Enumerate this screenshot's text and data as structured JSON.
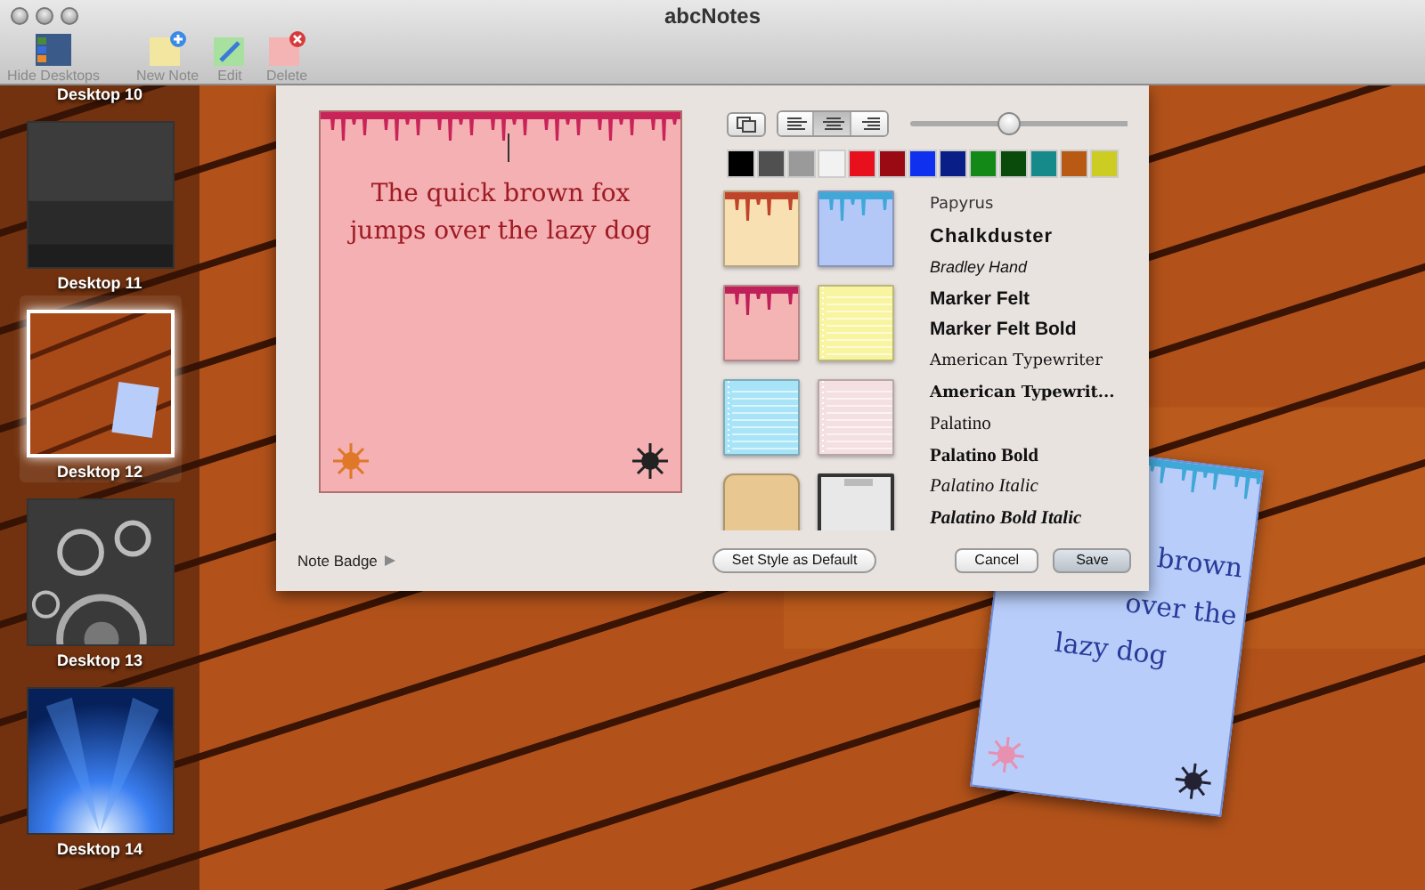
{
  "window": {
    "title": "abcNotes"
  },
  "toolbar": [
    {
      "label": "Hide Desktops",
      "kind": "desktops"
    },
    {
      "label": "New Note",
      "kind": "new"
    },
    {
      "label": "Edit",
      "kind": "edit"
    },
    {
      "label": "Delete",
      "kind": "delete"
    }
  ],
  "sidebar": {
    "items": [
      {
        "label": "Desktop 10",
        "kind": "label",
        "selected": false
      },
      {
        "label": "Desktop 11",
        "kind": "thumbnail",
        "selected": false
      },
      {
        "label": "Desktop 12",
        "kind": "thumbnail",
        "selected": true
      },
      {
        "label": "Desktop 13",
        "kind": "thumbnail",
        "selected": false
      },
      {
        "label": "Desktop 14",
        "kind": "thumbnail",
        "selected": false
      }
    ]
  },
  "style_sheet": {
    "preview": {
      "text": "The quick brown fox jumps over the lazy dog"
    },
    "alignment": [
      {
        "kind": "left",
        "selected": false
      },
      {
        "kind": "center",
        "selected": true
      },
      {
        "kind": "right",
        "selected": false
      }
    ],
    "size_slider": {
      "level": 0.45
    },
    "colors": [
      {
        "color": "#000000"
      },
      {
        "color": "#505050"
      },
      {
        "color": "#9a9a9a"
      },
      {
        "color": "#f2f2f2"
      },
      {
        "color": "#e8101c"
      },
      {
        "color": "#9a0a12"
      },
      {
        "color": "#1030f0"
      },
      {
        "color": "#0a1e88"
      },
      {
        "color": "#138a18"
      },
      {
        "color": "#0a4a0a"
      },
      {
        "color": "#168a8a"
      },
      {
        "color": "#b85a14"
      },
      {
        "color": "#cccc22"
      }
    ],
    "papers": [
      {
        "kind": "drips",
        "color": "#f8e0b2"
      },
      {
        "kind": "drips",
        "color": "#b4c8f8"
      },
      {
        "kind": "drips",
        "color": "#f4b4b4"
      },
      {
        "kind": "lined",
        "color": "#f8f4a0"
      },
      {
        "kind": "lined",
        "color": "#a8e4f8"
      },
      {
        "kind": "lined",
        "color": "#f4e0e0"
      },
      {
        "kind": "parchment",
        "color": "#e8c890"
      },
      {
        "kind": "clipboard",
        "color": "#e8e8e8"
      }
    ],
    "fonts": [
      {
        "name": "Papyrus",
        "kind": "papyrus"
      },
      {
        "name": "Chalkduster",
        "kind": "chalk"
      },
      {
        "name": "Bradley Hand",
        "kind": "hand"
      },
      {
        "name": "Marker Felt",
        "kind": "marker"
      },
      {
        "name": "Marker Felt Bold",
        "kind": "marker-bold"
      },
      {
        "name": "American Typewriter",
        "kind": "typewriter"
      },
      {
        "name": "American Typewrit...",
        "kind": "typewriter-bold"
      },
      {
        "name": "Palatino",
        "kind": "serif"
      },
      {
        "name": "Palatino Bold",
        "kind": "serif-bold"
      },
      {
        "name": "Palatino Italic",
        "kind": "serif-italic"
      },
      {
        "name": "Palatino Bold Italic",
        "kind": "serif-bold-italic"
      }
    ],
    "badge": {
      "label": "Note Badge",
      "expanded": false
    },
    "buttons": [
      {
        "label": "Set Style as Default",
        "kind": "default"
      },
      {
        "label": "Cancel",
        "kind": "cancel"
      },
      {
        "label": "Save",
        "kind": "save"
      }
    ]
  },
  "note": {
    "lines": [
      "brown",
      "over the",
      "lazy dog"
    ]
  }
}
